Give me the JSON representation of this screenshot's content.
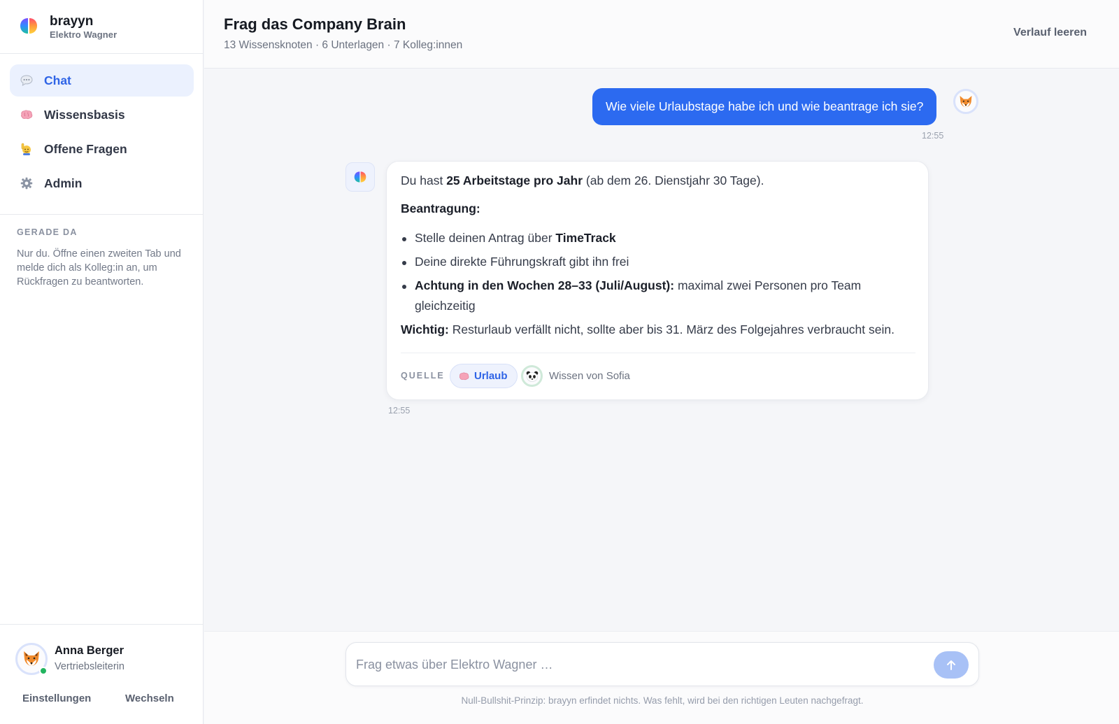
{
  "brand": {
    "name": "brayyn",
    "org": "Elektro Wagner"
  },
  "nav": [
    {
      "label": "Chat",
      "icon": "speech-bubble-icon",
      "active": true
    },
    {
      "label": "Wissensbasis",
      "icon": "brain-icon",
      "active": false
    },
    {
      "label": "Offene Fragen",
      "icon": "raising-hand-icon",
      "active": false
    },
    {
      "label": "Admin",
      "icon": "gear-icon",
      "active": false
    }
  ],
  "presence": {
    "title": "GERADE DA",
    "text": "Nur du. Öffne einen zweiten Tab und melde dich als Kolleg:in an, um Rückfragen zu beantworten."
  },
  "user": {
    "name": "Anna Berger",
    "role": "Vertriebsleiterin",
    "avatar_icon": "fox-icon",
    "settings_label": "Einstellungen",
    "switch_label": "Wechseln"
  },
  "header": {
    "title": "Frag das Company Brain",
    "subtitle": "13 Wissensknoten · 6 Unterlagen · 7 Kolleg:innen",
    "clear_label": "Verlauf leeren"
  },
  "messages": {
    "user": {
      "text": "Wie viele Urlaubstage habe ich und wie beantrage ich sie?",
      "time": "12:55"
    },
    "bot": {
      "p1_pre": "Du hast ",
      "p1_bold": "25 Arbeitstage pro Jahr",
      "p1_post": " (ab dem 26. Dienstjahr 30 Tage).",
      "heading": "Beantragung:",
      "b1_pre": "Stelle deinen Antrag über ",
      "b1_bold": "TimeTrack",
      "b2": "Deine direkte Führungskraft gibt ihn frei",
      "b3_bold": "Achtung in den Wochen 28–33 (Juli/August):",
      "b3_post": " maximal zwei Personen pro Team gleichzeitig",
      "important_bold": "Wichtig:",
      "important_post": " Resturlaub verfällt nicht, sollte aber bis 31. März des Folgejahres verbraucht sein.",
      "source_label": "QUELLE",
      "source_chip": "Urlaub",
      "source_person": "Wissen von Sofia",
      "time": "12:55"
    }
  },
  "composer": {
    "placeholder": "Frag etwas über Elektro Wagner …",
    "footnote": "Null-Bullshit-Prinzip: brayyn erfindet nichts. Was fehlt, wird bei den richtigen Leuten nachgefragt."
  },
  "colors": {
    "accent": "#2c6af0",
    "accent_soft": "#ebf1fe",
    "online": "#22b45f"
  }
}
